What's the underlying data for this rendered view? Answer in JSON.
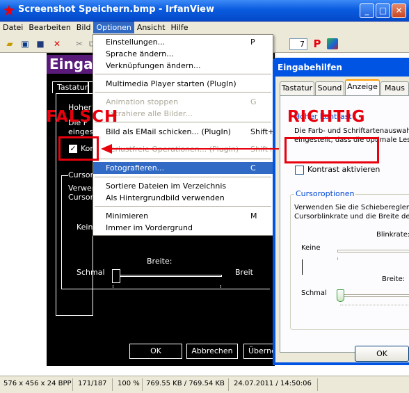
{
  "window": {
    "title": "Screenshot Speichern.bmp - IrfanView",
    "minimize": "_",
    "maximize": "□",
    "close": "✕"
  },
  "menubar": {
    "items": [
      "Datei",
      "Bearbeiten",
      "Bild",
      "Optionen",
      "Ansicht",
      "Hilfe"
    ]
  },
  "toolbar": {
    "page_field_value": "7",
    "p_label": "P"
  },
  "options_menu": {
    "items": [
      {
        "label": "Einstellungen...",
        "shortcut": "P"
      },
      {
        "label": "Sprache ändern...",
        "shortcut": ""
      },
      {
        "label": "Verknüpfungen ändern...",
        "shortcut": ""
      },
      {
        "label": "Multimedia Player starten (PlugIn)",
        "shortcut": ""
      },
      {
        "label": "Animation stoppen",
        "shortcut": "G"
      },
      {
        "label": "Extrahiere alle Bilder...",
        "shortcut": ""
      },
      {
        "label": "Bild als EMail schicken... (PlugIn)",
        "shortcut": "Shift+M"
      },
      {
        "label": "Verlustfreie Operationen... (PlugIn)",
        "shortcut": "Shift+J"
      },
      {
        "label": "Fotografieren...",
        "shortcut": "C"
      },
      {
        "label": "Sortiere Dateien im Verzeichnis",
        "shortcut": ""
      },
      {
        "label": "Als Hintergrundbild verwenden",
        "shortcut": ""
      },
      {
        "label": "Minimieren",
        "shortcut": "M"
      },
      {
        "label": "Immer im Vordergrund",
        "shortcut": ""
      }
    ]
  },
  "black_dialog": {
    "title": "Einga",
    "tab": "Tastatur",
    "tab2": "S",
    "hoher": "Hoher K",
    "die": "Die F",
    "einges": "eingest",
    "kontrast": "Kon",
    "cursor_group": "Cursoro",
    "verwenden": "Verwen",
    "cursorb": "Cursorb",
    "keine": "Keine",
    "breite": "Breite:",
    "schmal": "Schmal",
    "breit": "Breit",
    "ok": "OK",
    "abbrechen": "Abbrechen",
    "uebernehmen": "Überne"
  },
  "labels": {
    "falsch": "FALSCH",
    "richtig": "RICHTIG"
  },
  "dialog": {
    "title": "Eingabehilfen",
    "tabs": [
      "Tastatur",
      "Sound",
      "Anzeige",
      "Maus"
    ],
    "hoher_kontrast": "Hoher Kontrast",
    "desc_line1": "Die Farb- und Schriftartenauswahl",
    "desc_line2": "eingestellt, dass die optimale Lesba",
    "checkbox_label": "Kontrast aktivieren",
    "cursor_group": "Cursoroptionen",
    "cursor_desc1": "Verwenden Sie die Schieberegler,",
    "cursor_desc2": "Cursorblinkrate und die Breite des C",
    "blinkrate": "Blinkrate:",
    "keine": "Keine",
    "breite": "Breite:",
    "schmal": "Schmal",
    "ok": "OK"
  },
  "statusbar": {
    "dimensions": "576 x 456 x 24 BPP",
    "index": "171/187",
    "zoom": "100 %",
    "size": "769.55 KB / 769.54 KB",
    "datetime": "24.07.2011 / 14:50:06"
  },
  "colors": {
    "accent_red": "#e8000d",
    "highlight": "#316ac5",
    "xp_blue": "#0054e3"
  }
}
